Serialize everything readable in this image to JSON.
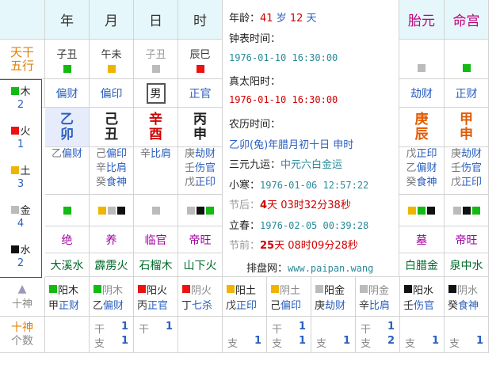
{
  "header": {
    "cols": [
      "年",
      "月",
      "日",
      "时"
    ],
    "right_cols": [
      "胎元",
      "命宫"
    ]
  },
  "tiangan_label": [
    "天干",
    "五行"
  ],
  "row1": {
    "ganzhi_small": [
      "子丑",
      "午未",
      "子丑",
      "辰巳"
    ],
    "colors": [
      "#11bb11",
      "#f0b400",
      "#bbbbbb",
      "#ee1111"
    ]
  },
  "right_row1": {
    "colors": [
      "#bbbbbb",
      "#11bb11"
    ]
  },
  "shishen": [
    "偏财",
    "偏印",
    "男",
    "正官"
  ],
  "right_shishen": [
    "劫财",
    "正财"
  ],
  "ganzhi": [
    {
      "gan": "乙",
      "zhi": "卯",
      "color": "#2a5fbf"
    },
    {
      "gan": "己",
      "zhi": "丑",
      "color": "#222222"
    },
    {
      "gan": "辛",
      "zhi": "酉",
      "color": "#d00000"
    },
    {
      "gan": "丙",
      "zhi": "申",
      "color": "#222222"
    }
  ],
  "right_ganzhi": [
    {
      "gan": "庚",
      "zhi": "辰",
      "color": "#e05a00"
    },
    {
      "gan": "甲",
      "zhi": "申",
      "color": "#e05a00"
    }
  ],
  "canggan": [
    [
      {
        "g": "乙",
        "s": "偏财"
      }
    ],
    [
      {
        "g": "己",
        "s": "偏印"
      },
      {
        "g": "辛",
        "s": "比肩"
      },
      {
        "g": "癸",
        "s": "食神"
      }
    ],
    [
      {
        "g": "辛",
        "s": "比肩"
      }
    ],
    [
      {
        "g": "庚",
        "s": "劫财"
      },
      {
        "g": "壬",
        "s": "伤官"
      },
      {
        "g": "戊",
        "s": "正印"
      }
    ]
  ],
  "right_canggan": [
    [
      {
        "g": "戊",
        "s": "正印"
      },
      {
        "g": "乙",
        "s": "偏财"
      },
      {
        "g": "癸",
        "s": "食神"
      }
    ],
    [
      {
        "g": "庚",
        "s": "劫财"
      },
      {
        "g": "壬",
        "s": "伤官"
      },
      {
        "g": "戊",
        "s": "正印"
      }
    ]
  ],
  "square_rows": [
    [
      "#11bb11"
    ],
    [
      "#f0b400",
      "#bbbbbb",
      "#111111"
    ],
    [
      "#bbbbbb"
    ],
    [
      "#bbbbbb",
      "#111111",
      "#11bb11"
    ]
  ],
  "right_square_rows": [
    [
      "#f0b400",
      "#11bb11",
      "#111111"
    ],
    [
      "#bbbbbb",
      "#111111",
      "#11bb11"
    ]
  ],
  "changsheng": [
    "绝",
    "养",
    "临官",
    "帝旺"
  ],
  "right_changsheng": [
    "墓",
    "帝旺"
  ],
  "nayin": [
    "大溪水",
    "霹雳火",
    "石榴木",
    "山下火"
  ],
  "right_nayin": [
    "白腊金",
    "泉中水"
  ],
  "left_panel": [
    {
      "name": "木",
      "num": "2",
      "color": "#11bb11"
    },
    {
      "name": "火",
      "num": "1",
      "color": "#ee1111"
    },
    {
      "name": "土",
      "num": "3",
      "color": "#f0b400"
    },
    {
      "name": "金",
      "num": "4",
      "color": "#bbbbbb"
    },
    {
      "name": "水",
      "num": "2",
      "color": "#111111"
    }
  ],
  "middle": {
    "age_label": "年龄：",
    "age_num": "41",
    "age_unit": "岁",
    "day_num": "12",
    "day_unit": "天",
    "clock_label": "钟表时间：",
    "clock_val": "1976-01-10 16:30:00",
    "solar_label": "真太阳时：",
    "solar_val": "1976-01-10 16:30:00",
    "lunar_label": "农历时间：",
    "lunar_val": "乙卯(兔)年腊月初十日 申时",
    "yun_label": "三元九运：",
    "yun_val": "中元六白金运",
    "xiaohan_label": "小寒：",
    "xiaohan_val": "1976-01-06 12:57:22",
    "jiehou_label": "节后：",
    "jiehou_d": "4",
    "jiehou_rest": "天 03时32分38秒",
    "lichun_label": "立春：",
    "lichun_val": "1976-02-05 00:39:28",
    "jieqian_label": "节前：",
    "jieqian_d": "25",
    "jieqian_rest": "天 08时09分28秒",
    "site_label": "排盘网：",
    "site_val": "www.paipan.wang"
  },
  "shishen_label": "十神",
  "bottom_cells": [
    {
      "c1": "#11bb11",
      "t1": "阳木",
      "g": "甲",
      "s": "正财"
    },
    {
      "c1": "#11bb11",
      "t1": "阴木",
      "g": "乙",
      "s": "偏财"
    },
    {
      "c1": "#ee1111",
      "t1": "阳火",
      "g": "丙",
      "s": "正官"
    },
    {
      "c1": "#ee1111",
      "t1": "阴火",
      "g": "丁",
      "s": "七杀"
    },
    {
      "c1": "#f0b400",
      "t1": "阳土",
      "g": "戊",
      "s": "正印"
    },
    {
      "c1": "#f0b400",
      "t1": "阴土",
      "g": "己",
      "s": "偏印"
    },
    {
      "c1": "#bbbbbb",
      "t1": "阳金",
      "g": "庚",
      "s": "劫财"
    },
    {
      "c1": "#bbbbbb",
      "t1": "阴金",
      "g": "辛",
      "s": "比肩"
    },
    {
      "c1": "#111111",
      "t1": "阳水",
      "g": "壬",
      "s": "伤官"
    },
    {
      "c1": "#111111",
      "t1": "阴水",
      "g": "癸",
      "s": "食神"
    }
  ],
  "count_label": [
    "十神",
    "个数"
  ],
  "counts": [
    {
      "gan": "",
      "gn": "",
      "zhi": "",
      "zn": ""
    },
    {
      "gan": "干",
      "gn": "1",
      "zhi": "支",
      "zn": "1"
    },
    {
      "gan": "干",
      "gn": "1",
      "zhi": "",
      "zn": ""
    },
    {
      "gan": "",
      "gn": "",
      "zhi": "",
      "zn": ""
    },
    {
      "gan": "",
      "gn": "",
      "zhi": "支",
      "zn": "1"
    },
    {
      "gan": "干",
      "gn": "1",
      "zhi": "支",
      "zn": "1"
    },
    {
      "gan": "",
      "gn": "",
      "zhi": "支",
      "zn": "1"
    },
    {
      "gan": "干",
      "gn": "1",
      "zhi": "支",
      "zn": "2"
    },
    {
      "gan": "",
      "gn": "",
      "zhi": "支",
      "zn": "1"
    },
    {
      "gan": "",
      "gn": "",
      "zhi": "支",
      "zn": "1"
    }
  ]
}
